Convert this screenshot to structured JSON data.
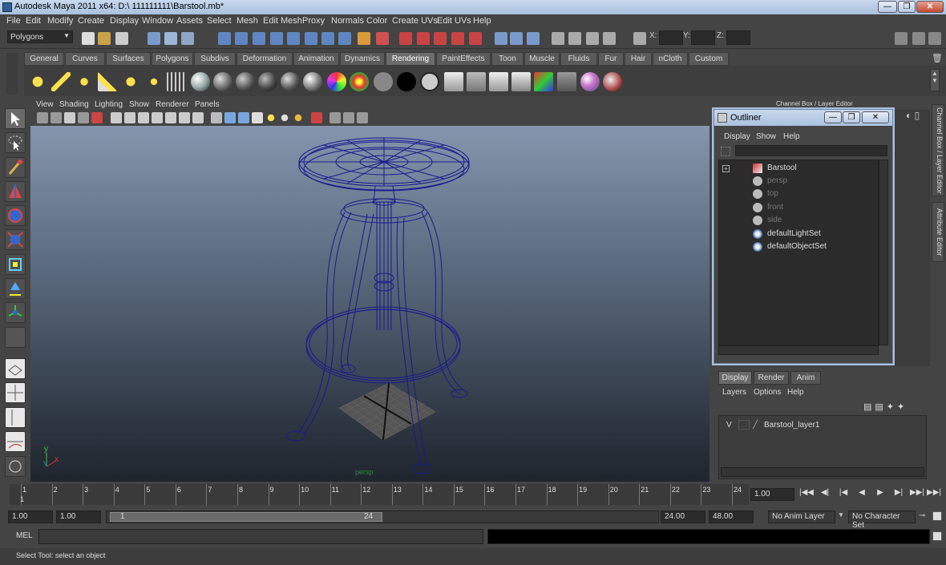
{
  "window": {
    "title": "Autodesk Maya 2011 x64: D:\\ 111111111\\Barstool.mb*",
    "min": "—",
    "max": "❐",
    "close": "✕"
  },
  "menubar": [
    "File",
    "Edit",
    "Modify",
    "Create",
    "Display",
    "Window",
    "Assets",
    "Select",
    "Mesh",
    "Edit Mesh",
    "Proxy",
    "Normals",
    "Color",
    "Create UVs",
    "Edit UVs",
    "Help"
  ],
  "statusline": {
    "menuset": "Polygons",
    "x_label": "X:",
    "y_label": "Y:",
    "z_label": "Z:"
  },
  "shelf_tabs": [
    "General",
    "Curves",
    "Surfaces",
    "Polygons",
    "Subdivs",
    "Deformation",
    "Animation",
    "Dynamics",
    "Rendering",
    "PaintEffects",
    "Toon",
    "Muscle",
    "Fluids",
    "Fur",
    "Hair",
    "nCloth",
    "Custom"
  ],
  "shelf_active": "Rendering",
  "viewport": {
    "menus": [
      "View",
      "Shading",
      "Lighting",
      "Show",
      "Renderer",
      "Panels"
    ],
    "camera": "persp",
    "axis_y": "y",
    "axis_x": "x"
  },
  "right_panel": {
    "title": "Channel Box / Layer Editor",
    "side_tab_1": "Channel Box / Layer Editor",
    "side_tab_2": "Attribute Editor"
  },
  "outliner": {
    "title": "Outliner",
    "menus": [
      "Display",
      "Show",
      "Help"
    ],
    "items": [
      {
        "label": "Barstool",
        "dim": false,
        "icon": "mesh-icon"
      },
      {
        "label": "persp",
        "dim": true,
        "icon": "camera-icon"
      },
      {
        "label": "top",
        "dim": true,
        "icon": "camera-icon"
      },
      {
        "label": "front",
        "dim": true,
        "icon": "camera-icon"
      },
      {
        "label": "side",
        "dim": true,
        "icon": "camera-icon"
      },
      {
        "label": "defaultLightSet",
        "dim": false,
        "icon": "set-icon"
      },
      {
        "label": "defaultObjectSet",
        "dim": false,
        "icon": "set-icon"
      }
    ]
  },
  "layer_editor": {
    "tabs": [
      "Display",
      "Render",
      "Anim"
    ],
    "menus": [
      "Layers",
      "Options",
      "Help"
    ],
    "layer": {
      "visible": "V",
      "name": "Barstool_layer1"
    }
  },
  "timeslider": {
    "ticks": [
      "1",
      "2",
      "3",
      "4",
      "5",
      "6",
      "7",
      "8",
      "9",
      "10",
      "11",
      "12",
      "13",
      "14",
      "15",
      "16",
      "17",
      "18",
      "19",
      "20",
      "21",
      "22",
      "23",
      "24"
    ],
    "current_frame_label": "1",
    "current_time": "1.00"
  },
  "playback": [
    "|◀◀",
    "◀|",
    "|◀",
    "◀",
    "▶",
    "▶|",
    "▶▶|",
    "▶▶|"
  ],
  "range": {
    "start": "1.00",
    "playback_start": "1.00",
    "slider_start": "1",
    "slider_end": "24",
    "playback_end": "24.00",
    "end": "48.00",
    "anim_layer": "No Anim Layer",
    "character_set": "No Character Set"
  },
  "command": {
    "label": "MEL"
  },
  "help_line": "Select Tool: select an object",
  "colors": {
    "wire": "#1a1a8c",
    "ui_bg": "#444444",
    "active_tab": "#6b6b6b"
  }
}
